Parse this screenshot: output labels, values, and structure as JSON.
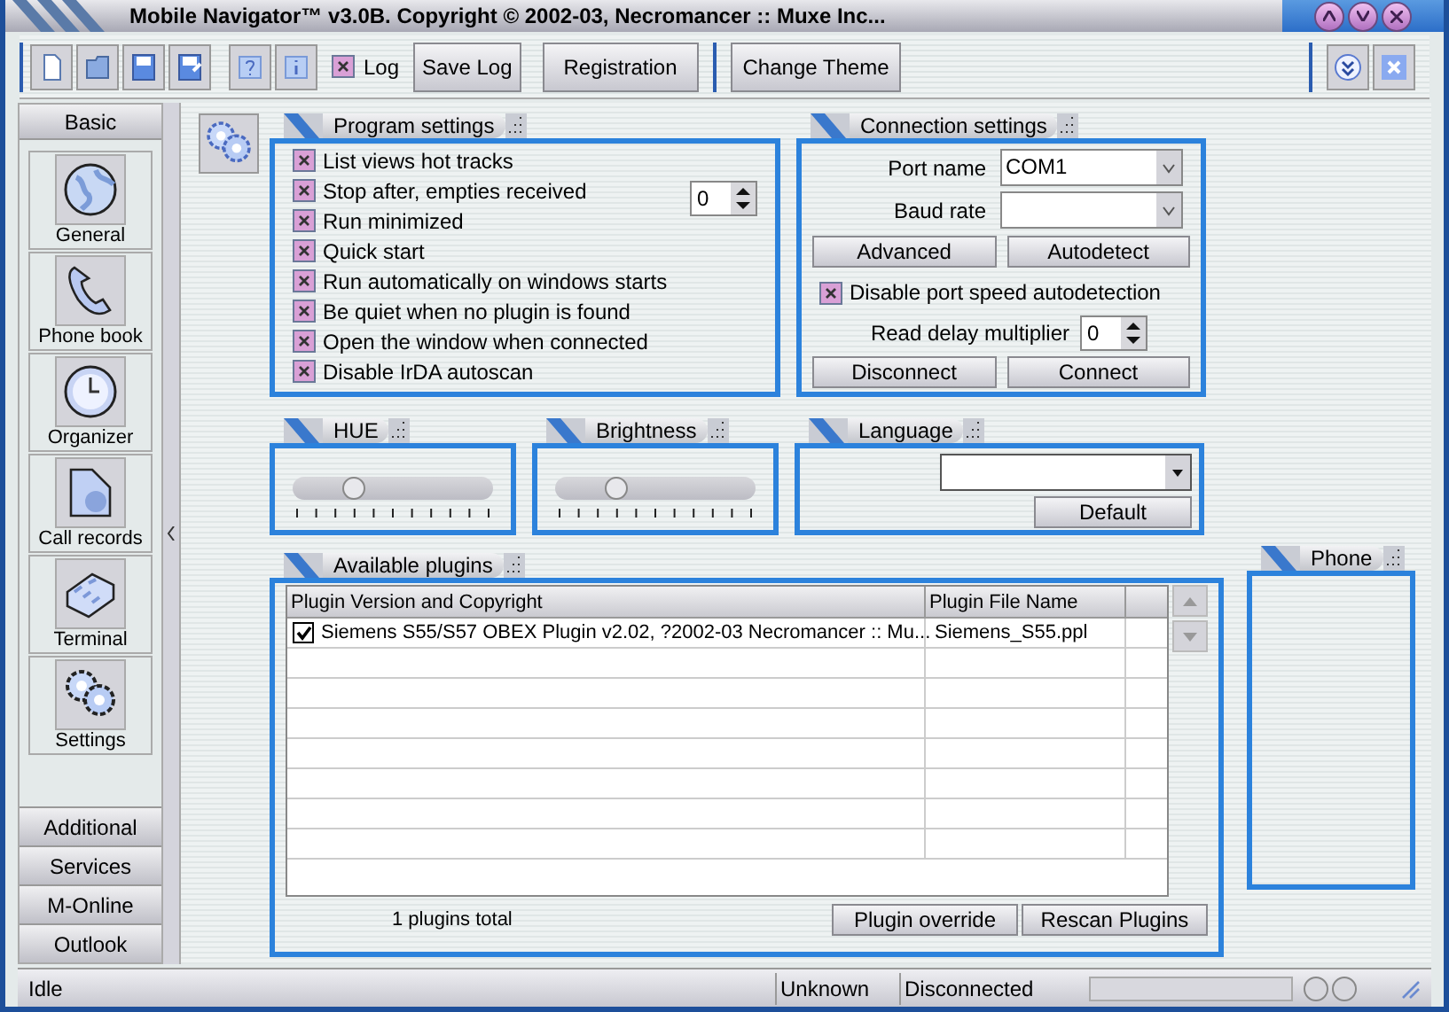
{
  "window": {
    "title": "Mobile Navigator™ v3.0B. Copyright © 2002-03, Necromancer :: Muxe Inc..."
  },
  "toolbar": {
    "log": {
      "label": "Log",
      "checked": true
    },
    "buttons": [
      "Save Log",
      "Registration",
      "Change Theme"
    ]
  },
  "sidebar": {
    "header": {
      "label": "Basic",
      "selected": true
    },
    "items": [
      {
        "label": "General"
      },
      {
        "label": "Phone book"
      },
      {
        "label": "Organizer"
      },
      {
        "label": "Call records"
      },
      {
        "label": "Terminal"
      },
      {
        "label": "Settings"
      }
    ],
    "sections": [
      "Additional",
      "Services",
      "M-Online",
      "Outlook"
    ]
  },
  "program_settings": {
    "title": "Program settings",
    "spin_value": "0",
    "options": [
      {
        "label": "List views hot tracks",
        "checked": true
      },
      {
        "label": "Stop after, empties received",
        "checked": true
      },
      {
        "label": "Run minimized",
        "checked": true
      },
      {
        "label": "Quick start",
        "checked": true
      },
      {
        "label": "Run automatically on windows starts",
        "checked": true
      },
      {
        "label": "Be quiet when no plugin is found",
        "checked": true
      },
      {
        "label": "Open the window when connected",
        "checked": true
      },
      {
        "label": "Disable IrDA autoscan",
        "checked": true
      }
    ]
  },
  "connection_settings": {
    "title": "Connection settings",
    "port_name": {
      "label": "Port name",
      "value": "COM1"
    },
    "baud_rate": {
      "label": "Baud rate"
    },
    "buttons_top": [
      "Advanced",
      "Autodetect"
    ],
    "disable_autodetect": {
      "label": "Disable port speed autodetection",
      "checked": true
    },
    "read_delay": {
      "label": "Read delay multiplier",
      "value": "0"
    },
    "buttons_bottom": [
      "Disconnect",
      "Connect"
    ]
  },
  "hue": {
    "title": "HUE",
    "level": 0.3
  },
  "brightness": {
    "title": "Brightness",
    "level": 0.3
  },
  "language": {
    "title": "Language",
    "button": "Default"
  },
  "plugins": {
    "title": "Available plugins",
    "columns": [
      "Plugin Version and Copyright",
      "Plugin File Name"
    ],
    "rows": [
      {
        "checked": true,
        "name": "Siemens S55/S57 OBEX Plugin v2.02, ?2002-03 Necromancer :: Mu...",
        "file": "Siemens_S55.ppl"
      }
    ],
    "total": "1 plugins total",
    "buttons": [
      "Plugin override",
      "Rescan Plugins"
    ]
  },
  "phone": {
    "title": "Phone"
  },
  "status_bar": [
    "Idle",
    "Unknown",
    "Disconnected"
  ],
  "progress": {
    "level": 0
  }
}
